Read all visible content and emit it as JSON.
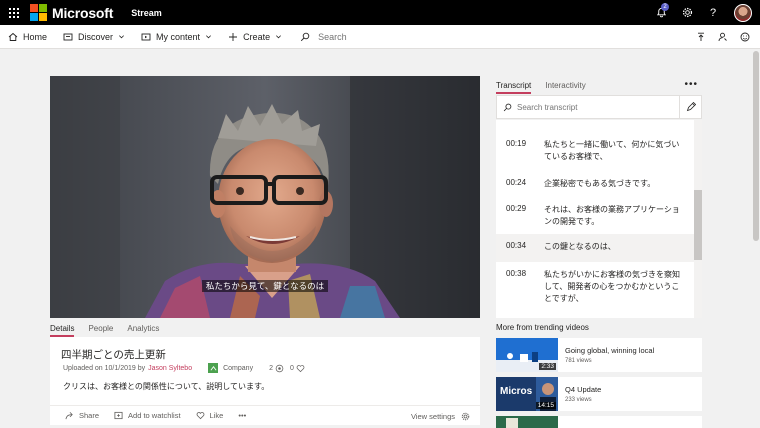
{
  "app": {
    "brand": "Microsoft",
    "name": "Stream",
    "notification_count": "2"
  },
  "colors": {
    "accent": "#c43e5e",
    "topbar": "#000000",
    "company_badge": "#4ca14f"
  },
  "nav": {
    "home": "Home",
    "discover": "Discover",
    "my_content": "My content",
    "create": "Create",
    "search_placeholder": "Search"
  },
  "video": {
    "caption": "私たちから見て、鍵となるのは"
  },
  "tabs": [
    "Details",
    "People",
    "Analytics"
  ],
  "details": {
    "title": "四半期ごとの売上更新",
    "uploaded": "Uploaded on 10/1/2019 by",
    "author": "Jason Syltebo",
    "company": "Company",
    "views": "2",
    "likes": "0",
    "description": "クリスは、お客様との関係性について、説明しています。"
  },
  "actions": {
    "share": "Share",
    "watchlist": "Add to watchlist",
    "like": "Like",
    "more": "•••",
    "settings": "View settings"
  },
  "transcript_panel": {
    "tabs": [
      "Transcript",
      "Interactivity"
    ],
    "more": "•••",
    "search_placeholder": "Search transcript",
    "entries": [
      {
        "time": "00:19",
        "text": "私たちと一緒に働いて、何かに気づいているお客様で、"
      },
      {
        "time": "00:24",
        "text": "企業秘密でもある気づきです。"
      },
      {
        "time": "00:29",
        "text": "それは、お客様の業務アプリケーションの開発です。"
      },
      {
        "time": "00:34",
        "text": "この鍵となるのは、"
      },
      {
        "time": "00:38",
        "text": "私たちがいかにお客様の気づきを察知して、開発者の心をつかむかということですが、"
      }
    ]
  },
  "trending": {
    "title": "More from trending videos",
    "items": [
      {
        "title": "Going global, winning local",
        "views": "781 views",
        "duration": "2:33"
      },
      {
        "title": "Q4 Update",
        "views": "233 views",
        "duration": "14:15",
        "thumb_text": "Micros"
      }
    ]
  }
}
